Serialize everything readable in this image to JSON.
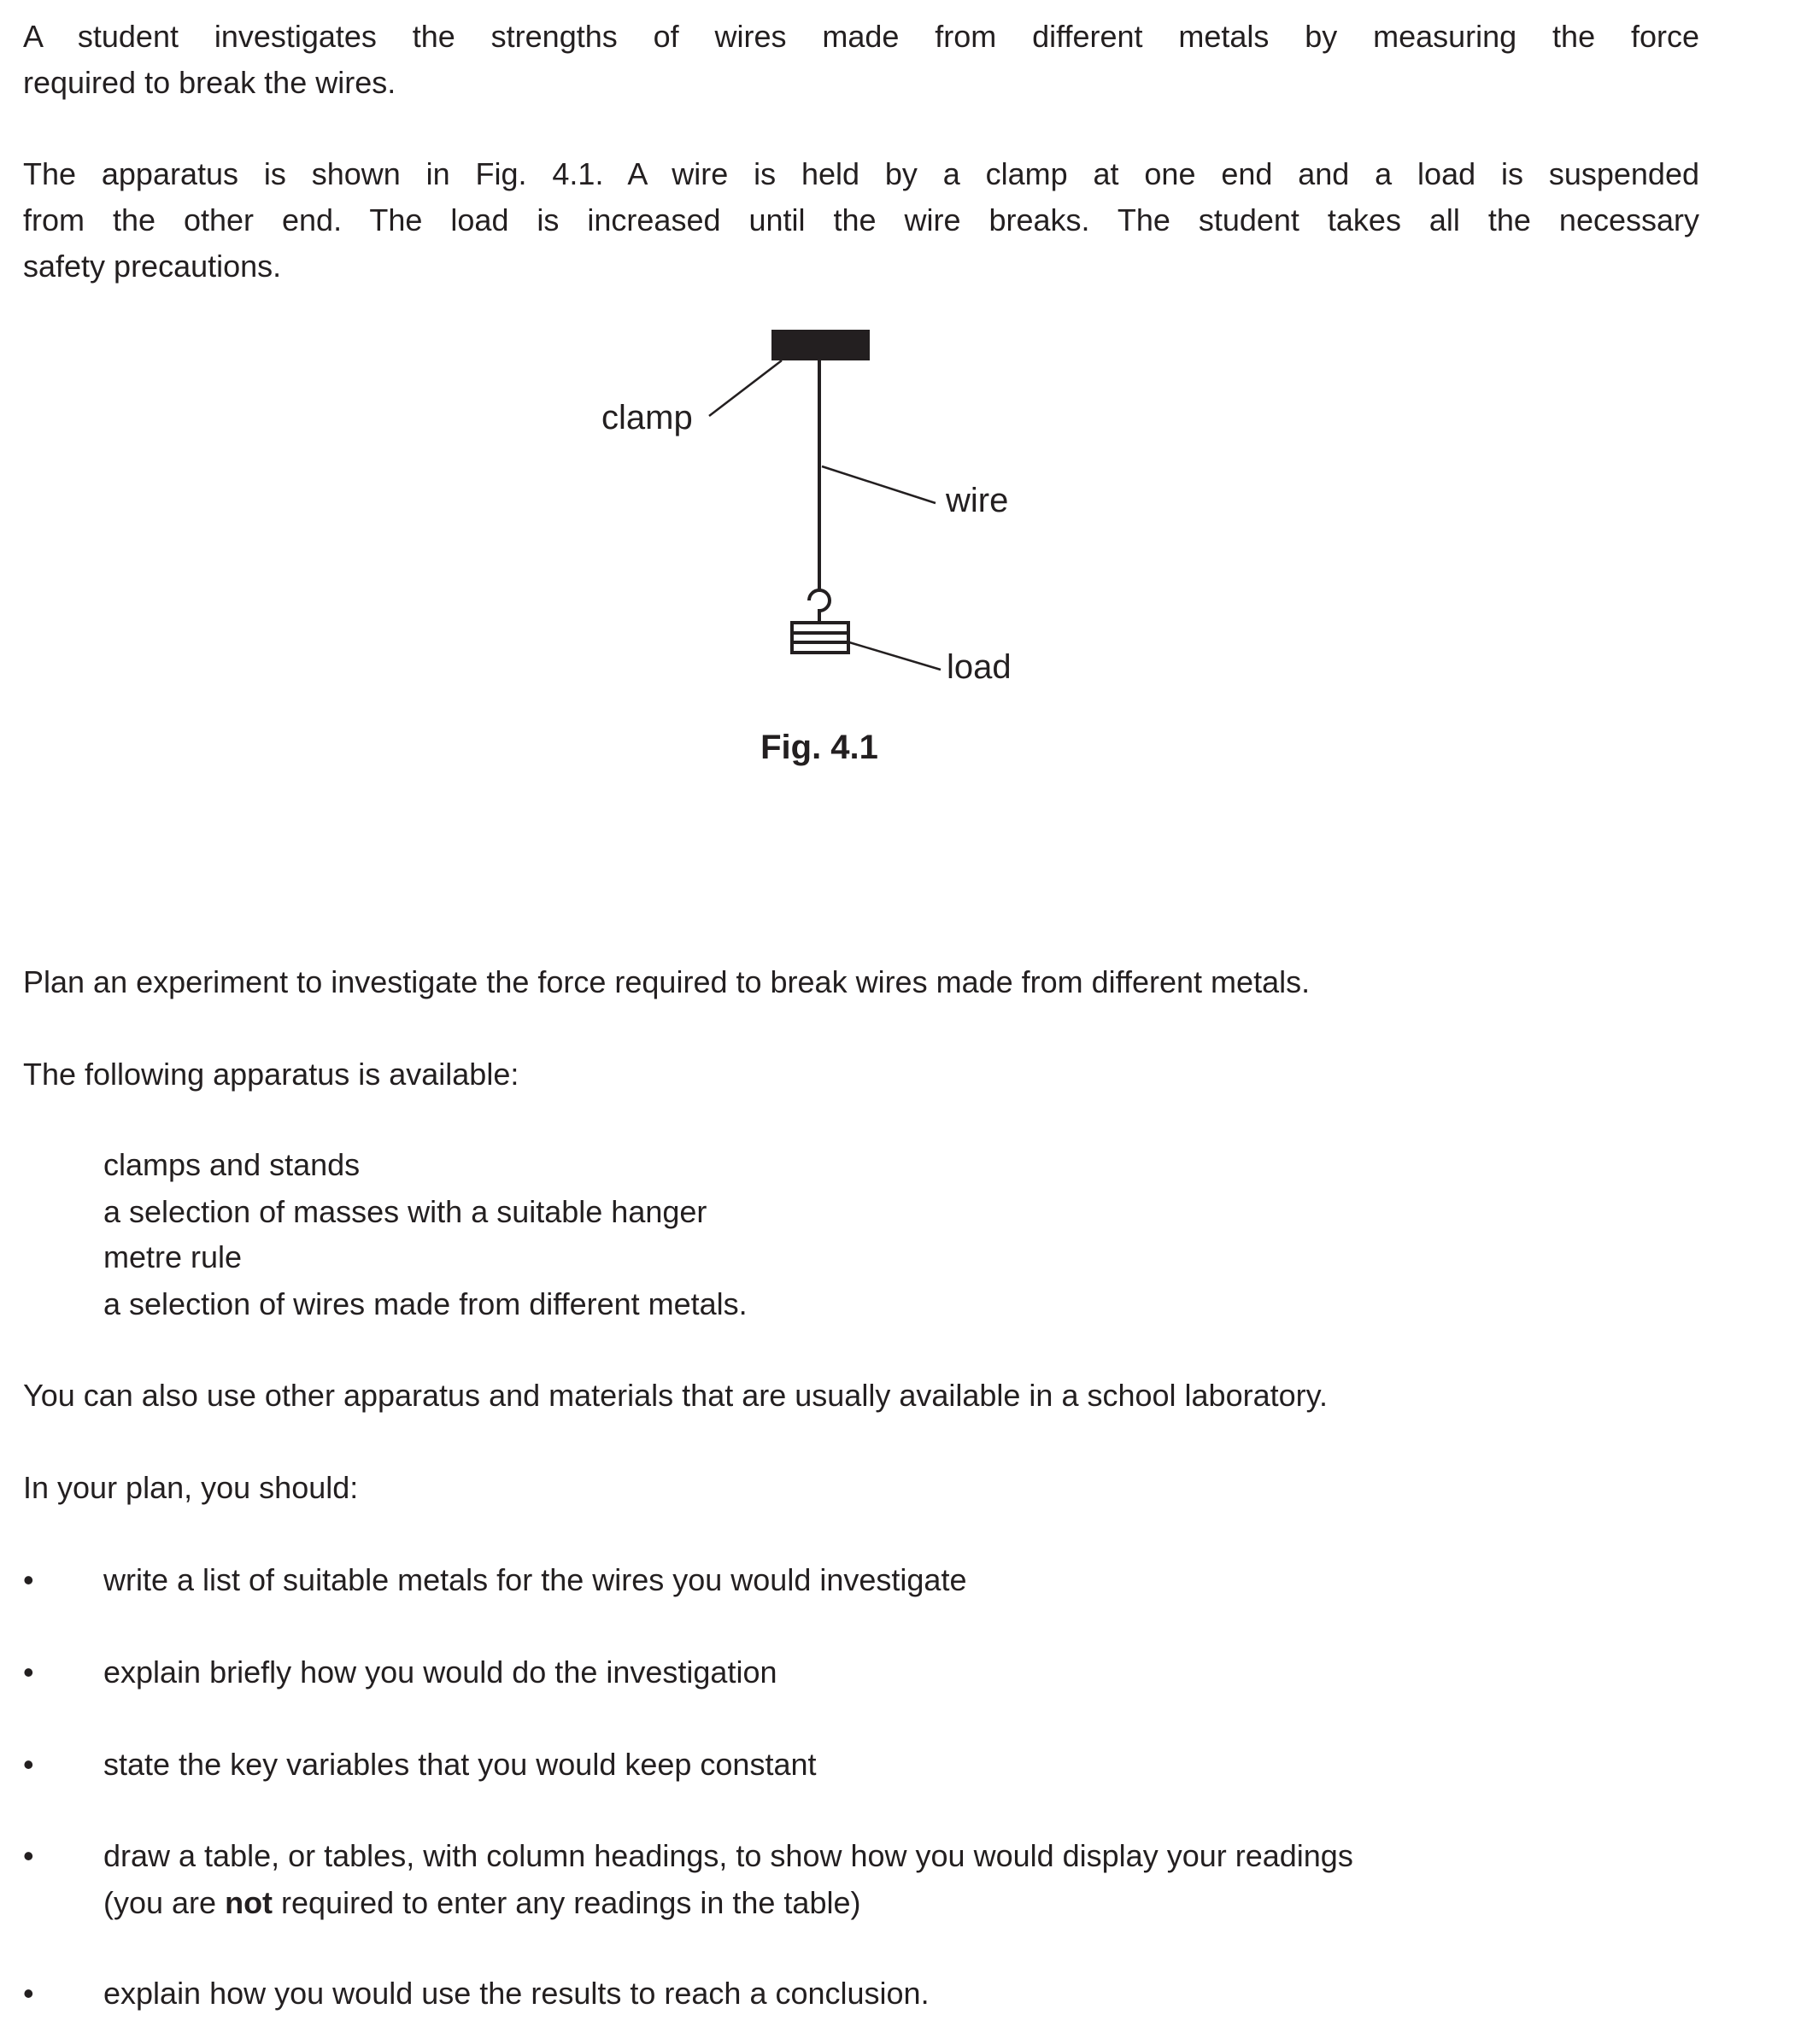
{
  "intro": {
    "p1": [
      "A student investigates the strengths of wires made from different metals by measuring the force",
      "required to break the wires."
    ],
    "p2": [
      "The apparatus is shown in Fig. 4.1. A wire is held by a clamp at one end and a load is suspended",
      "from the other end. The load is increased until the wire breaks. The student takes all the necessary",
      "safety precautions."
    ]
  },
  "figure": {
    "labels": {
      "clamp": "clamp",
      "wire": "wire",
      "load": "load"
    },
    "caption": "Fig. 4.1"
  },
  "task": "Plan an experiment to investigate the force required to break wires made from different metals.",
  "apparatus_intro": "The following apparatus is available:",
  "apparatus": [
    "clamps and stands",
    "a selection of masses with a suitable hanger",
    "metre rule",
    "a selection of wires made from different metals."
  ],
  "other": "You can also use other apparatus and materials that are usually available in a school laboratory.",
  "plan_intro": "In your plan, you should:",
  "bullet_char": "•",
  "bullets": {
    "b1": "write a list of suitable metals for the wires you would investigate",
    "b2": "explain briefly how you would do the investigation",
    "b3": "state the key variables that you would keep constant",
    "b4_line1": "draw a table, or tables, with column headings, to show how you would display your readings",
    "b4_pre": "(you are ",
    "b4_bold": "not",
    "b4_post": " required to enter any readings in the table)",
    "b5": "explain how you would use the results to reach a conclusion."
  }
}
